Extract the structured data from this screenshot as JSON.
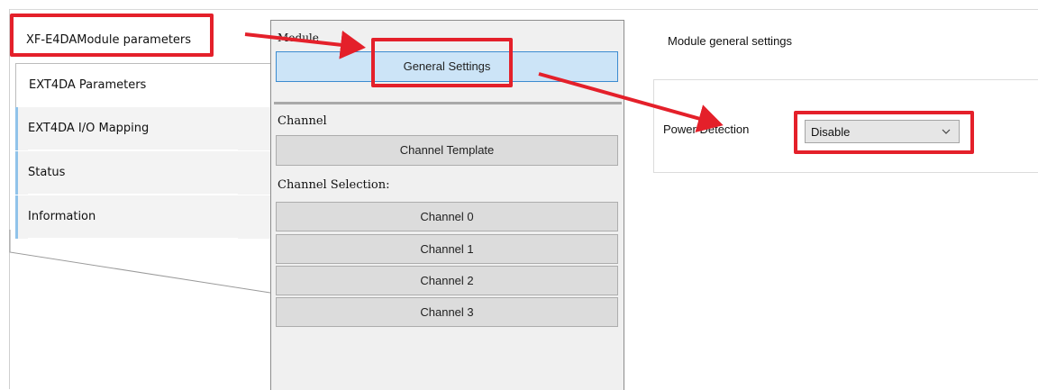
{
  "left_panel": {
    "header": "XF-E4DAModule parameters",
    "tabs": [
      {
        "label": "EXT4DA Parameters",
        "active": true
      },
      {
        "label": "EXT4DA I/O Mapping",
        "active": false
      },
      {
        "label": "Status",
        "active": false
      },
      {
        "label": "Information",
        "active": false
      }
    ]
  },
  "middle_panel": {
    "module_label": "Module",
    "general_settings_button": "General Settings",
    "channel_label": "Channel",
    "channel_template_button": "Channel Template",
    "channel_selection_label": "Channel Selection:",
    "channels": [
      "Channel 0",
      "Channel 1",
      "Channel 2",
      "Channel 3"
    ]
  },
  "right_panel": {
    "title": "Module general settings",
    "power_detection_label": "Power Detection",
    "power_detection_value": "Disable"
  },
  "annotation_color": "#e4202a"
}
